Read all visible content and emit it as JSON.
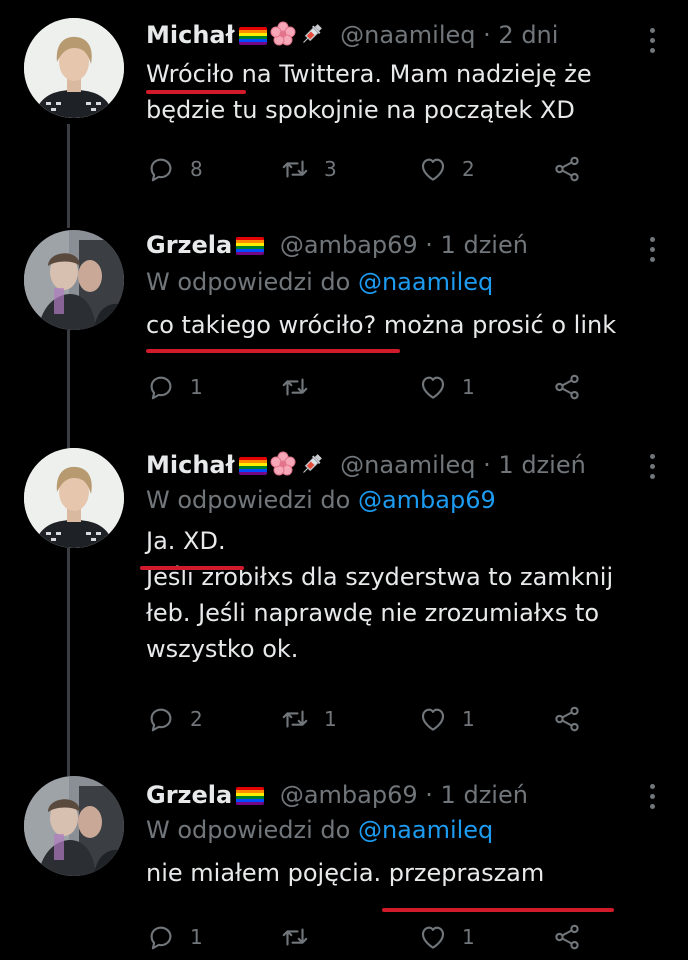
{
  "theme": {
    "background": "#000000",
    "text": "#e7e9ea",
    "muted": "#71767b",
    "link": "#1d9bf0",
    "annotation": "#d11a2a"
  },
  "tweets": [
    {
      "name": "Michał",
      "handle": "@naamileq",
      "time": "· 2 dni",
      "reply_prefix": "",
      "reply_mention": "",
      "lines": [
        "Wróciło na Twittera. Mam nadzieję że",
        "będzie tu spokojnie na początek XD"
      ],
      "replies": "8",
      "retweets": "3",
      "likes": "2",
      "avatar": "michal-avatar",
      "badges": [
        "rainbow-flag-icon",
        "flower-icon",
        "syringe-icon"
      ]
    },
    {
      "name": "Grzela",
      "handle": "@ambap69",
      "time": "· 1 dzień",
      "reply_prefix": "W odpowiedzi do",
      "reply_mention": "@naamileq",
      "lines": [
        "co takiego wróciło? można prosić o link"
      ],
      "replies": "1",
      "retweets": "",
      "likes": "1",
      "avatar": "grzela-avatar",
      "badges": [
        "rainbow-flag-icon"
      ]
    },
    {
      "name": "Michał",
      "handle": "@naamileq",
      "time": "· 1 dzień",
      "reply_prefix": "W odpowiedzi do",
      "reply_mention": "@ambap69",
      "lines": [
        "Ja. XD.",
        "Jeśli zrobiłxs dla szyderstwa to zamknij",
        "łeb. Jeśli naprawdę nie zrozumiałxs to",
        "wszystko ok."
      ],
      "replies": "2",
      "retweets": "1",
      "likes": "1",
      "avatar": "michal-avatar",
      "badges": [
        "rainbow-flag-icon",
        "flower-icon",
        "syringe-icon"
      ]
    },
    {
      "name": "Grzela",
      "handle": "@ambap69",
      "time": "· 1 dzień",
      "reply_prefix": "W odpowiedzi do",
      "reply_mention": "@naamileq",
      "lines": [
        "nie miałem pojęcia. przepraszam"
      ],
      "replies": "1",
      "retweets": "",
      "likes": "1",
      "avatar": "grzela-avatar",
      "badges": [
        "rainbow-flag-icon"
      ]
    }
  ]
}
